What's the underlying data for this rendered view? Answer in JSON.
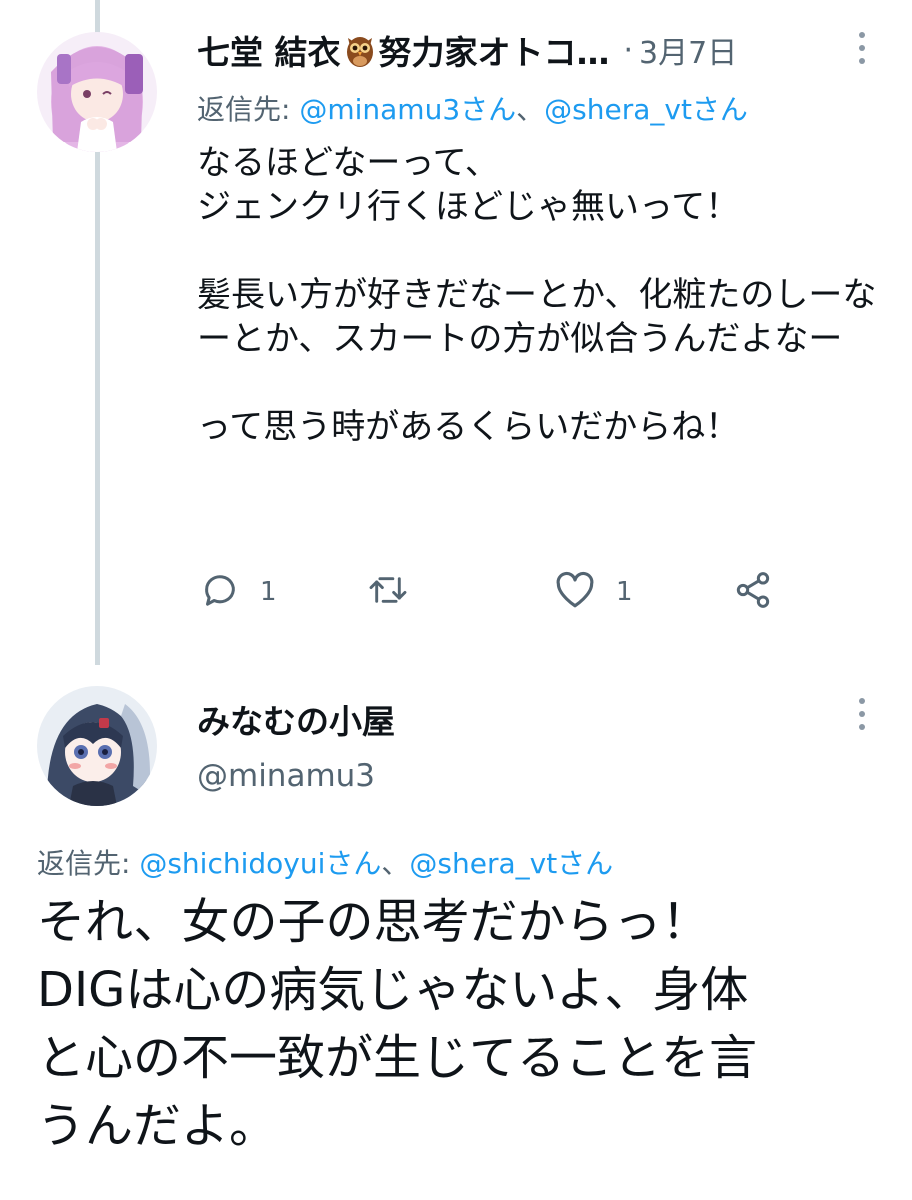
{
  "tweet1": {
    "display_name": "七堂 結衣",
    "display_name_rest": "努力家オトコ…",
    "separator": "·",
    "date": "3月7日",
    "reply_to_prefix": "返信先: ",
    "reply_to_mentions": [
      "@minamu3さん",
      "@shera_vtさん"
    ],
    "reply_to_joiner": "、",
    "body_paragraphs": [
      "なるほどなーって、\nジェンクリ行くほどじゃ無いって！",
      "髪長い方が好きだなーとか、化粧たのしーなーとか、スカートの方が似合うんだよなー",
      "って思う時があるくらいだからね！"
    ],
    "reply_count": "1",
    "like_count": "1"
  },
  "tweet2": {
    "display_name": "みなむの小屋",
    "handle": "@minamu3",
    "reply_to_prefix": "返信先: ",
    "reply_to_mentions": [
      "@shichidoyuiさん",
      "@shera_vtさん"
    ],
    "reply_to_joiner": "、",
    "body_lines": [
      "それ、女の子の思考だからっ！",
      "DIGは心の病気じゃないよ、身体",
      "と心の不一致が生じてることを言",
      "うんだよ。"
    ]
  },
  "colors": {
    "text": "#0f1419",
    "secondary": "#536471",
    "link": "#1d9bf0",
    "thread_line": "#cfd9de"
  },
  "icons": [
    "owl-emoji-icon",
    "more-options-icon",
    "reply-icon",
    "retweet-icon",
    "like-icon",
    "share-icon"
  ]
}
